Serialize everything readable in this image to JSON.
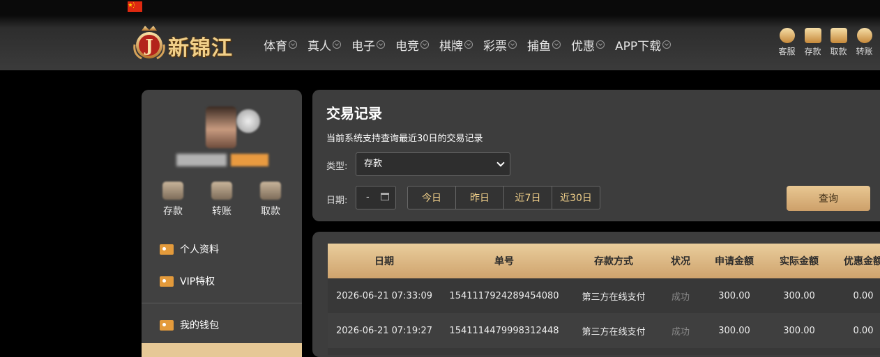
{
  "header": {
    "brand_name": "新锦江",
    "nav": [
      "体育",
      "真人",
      "电子",
      "电竞",
      "棋牌",
      "彩票",
      "捕鱼",
      "优惠",
      "APP下载"
    ],
    "quick": [
      "客服",
      "存款",
      "取款",
      "转账"
    ],
    "flag": "cn-flag",
    "accent_color": "#e6c896"
  },
  "sidebar": {
    "wallet_actions": [
      "存款",
      "转账",
      "取款"
    ],
    "menu": [
      "个人资料",
      "VIP特权",
      "我的钱包"
    ]
  },
  "panel": {
    "title": "交易记录",
    "subtitle": "当前系统支持查询最近30日的交易记录",
    "type_label": "类型:",
    "type_value": "存款",
    "date_label": "日期:",
    "date_value": "-",
    "ranges": [
      "今日",
      "昨日",
      "近7日",
      "近30日"
    ],
    "query": "查询"
  },
  "table": {
    "headers": [
      "日期",
      "单号",
      "存款方式",
      "状况",
      "申请金额",
      "实际金额",
      "优惠金额"
    ],
    "rows": [
      [
        "2026-06-21 07:33:09",
        "1541117924289454080",
        "第三方在线支付",
        "成功",
        "300.00",
        "300.00",
        "0.00"
      ],
      [
        "2026-06-21 07:19:27",
        "1541114479998312448",
        "第三方在线支付",
        "成功",
        "300.00",
        "300.00",
        "0.00"
      ]
    ]
  }
}
